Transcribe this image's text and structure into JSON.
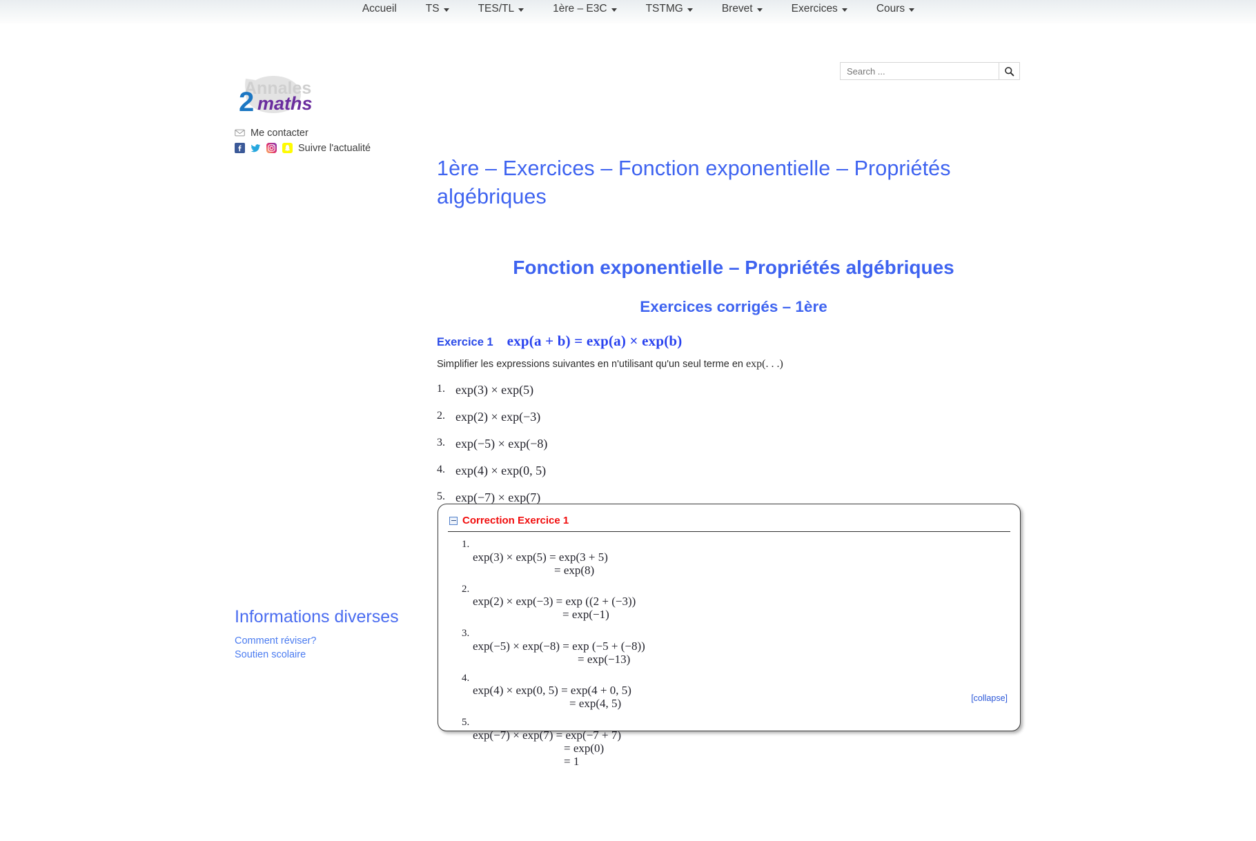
{
  "nav": {
    "items": [
      {
        "label": "Accueil",
        "has_dropdown": false
      },
      {
        "label": "TS",
        "has_dropdown": true
      },
      {
        "label": "TES/TL",
        "has_dropdown": true
      },
      {
        "label": "1ère – E3C",
        "has_dropdown": true
      },
      {
        "label": "TSTMG",
        "has_dropdown": true
      },
      {
        "label": "Brevet",
        "has_dropdown": true
      },
      {
        "label": "Exercices",
        "has_dropdown": true
      },
      {
        "label": "Cours",
        "has_dropdown": true
      }
    ]
  },
  "search": {
    "placeholder": "Search ...",
    "value": "",
    "icon": "search-icon"
  },
  "logo": {
    "word_top": "Annales",
    "digit": "2",
    "word_bottom": "maths",
    "color_gray": "#cfcfcf",
    "color_blue": "#1c77c3",
    "color_purple": "#6a2d9e"
  },
  "contact": {
    "mail_label": "Me contacter",
    "follow_label": "Suivre l'actualité",
    "icons": [
      "envelope-icon",
      "facebook-icon",
      "twitter-icon",
      "instagram-icon",
      "snapchat-icon"
    ]
  },
  "sidebar": {
    "title": "Informations diverses",
    "links": [
      {
        "label": "Comment réviser?"
      },
      {
        "label": "Soutien scolaire"
      }
    ]
  },
  "main": {
    "page_title": "1ère – Exercices – Fonction exponentielle – Propriétés algébriques",
    "heading_2": "Fonction exponentielle – Propriétés algébriques",
    "heading_3": "Exercices corrigés – 1ère",
    "exercise_label": "Exercice 1",
    "exercise_formula": "exp(a + b) = exp(a) × exp(b)",
    "intro_text": "Simplifier les expressions suivantes en n'utilisant qu'un seul terme en ",
    "intro_math": "exp(. . .)",
    "questions": [
      {
        "num": "1.",
        "text": "exp(3) × exp(5)"
      },
      {
        "num": "2.",
        "text": "exp(2) × exp(−3)"
      },
      {
        "num": "3.",
        "text": "exp(−5) × exp(−8)"
      },
      {
        "num": "4.",
        "text": "exp(4) × exp(0, 5)"
      },
      {
        "num": "5.",
        "text": "exp(−7) × exp(7)"
      }
    ]
  },
  "correction": {
    "title": "Correction Exercice 1",
    "toggle_icon": "minus-box-icon",
    "collapse_label": "[collapse]",
    "items": [
      {
        "num": "1.",
        "line1": "exp(3) × exp(5) = exp(3 + 5)",
        "lines": [
          "= exp(8)"
        ],
        "indent": [
          118
        ]
      },
      {
        "num": "2.",
        "line1": "exp(2) × exp(−3) = exp ((2 + (−3))",
        "lines": [
          "= exp(−1)"
        ],
        "indent": [
          130
        ]
      },
      {
        "num": "3.",
        "line1": "exp(−5) × exp(−8) = exp (−5 + (−8))",
        "lines": [
          "= exp(−13)"
        ],
        "indent": [
          152
        ]
      },
      {
        "num": "4.",
        "line1": "exp(4) × exp(0, 5) = exp(4 + 0, 5)",
        "lines": [
          "= exp(4, 5)"
        ],
        "indent": [
          140
        ]
      },
      {
        "num": "5.",
        "line1": "exp(−7) × exp(7) = exp(−7 + 7)",
        "lines": [
          "= exp(0)",
          "= 1"
        ],
        "indent": [
          132,
          132
        ]
      }
    ]
  }
}
